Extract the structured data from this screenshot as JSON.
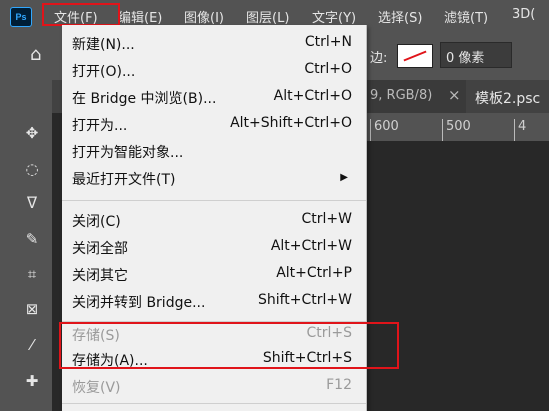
{
  "app": {
    "logo": "Ps"
  },
  "menubar": {
    "items": [
      {
        "label": "文件(F)"
      },
      {
        "label": "编辑(E)"
      },
      {
        "label": "图像(I)"
      },
      {
        "label": "图层(L)"
      },
      {
        "label": "文字(Y)"
      },
      {
        "label": "选择(S)"
      },
      {
        "label": "滤镜(T)"
      },
      {
        "label": "3D("
      }
    ]
  },
  "optionsbar": {
    "edge_label": "边:",
    "value": "0 像素"
  },
  "tabs": {
    "collapse": "››",
    "doc1_partial": "9, RGB/8)",
    "close": "×",
    "doc2": "模板2.psc"
  },
  "ruler": {
    "ticks": [
      "600",
      "500",
      "4"
    ]
  },
  "file_menu": {
    "items": [
      {
        "label": "新建(N)...",
        "shortcut": "Ctrl+N"
      },
      {
        "label": "打开(O)...",
        "shortcut": "Ctrl+O"
      },
      {
        "label": "在 Bridge 中浏览(B)...",
        "shortcut": "Alt+Ctrl+O"
      },
      {
        "label": "打开为...",
        "shortcut": "Alt+Shift+Ctrl+O"
      },
      {
        "label": "打开为智能对象..."
      },
      {
        "label": "最近打开文件(T)",
        "submenu_arrow": "▶"
      },
      {
        "label": "关闭(C)",
        "shortcut": "Ctrl+W"
      },
      {
        "label": "关闭全部",
        "shortcut": "Alt+Ctrl+W"
      },
      {
        "label": "关闭其它",
        "shortcut": "Alt+Ctrl+P"
      },
      {
        "label": "关闭并转到 Bridge...",
        "shortcut": "Shift+Ctrl+W"
      },
      {
        "label": "存储(S)",
        "shortcut": "Ctrl+S"
      },
      {
        "label": "存储为(A)...",
        "shortcut": "Shift+Ctrl+S"
      },
      {
        "label": "恢复(V)",
        "shortcut": "F12"
      }
    ]
  },
  "colors": {
    "highlight": "#e0141a",
    "menu_bg": "#f0f0f0",
    "chrome": "#535353"
  }
}
